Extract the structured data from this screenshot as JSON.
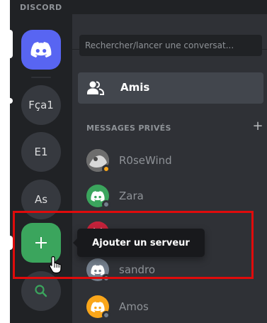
{
  "app": {
    "wordmark": "DISCORD"
  },
  "servers": [
    {
      "label": "Fça1"
    },
    {
      "label": "E1"
    },
    {
      "label": "As"
    }
  ],
  "search": {
    "placeholder": "Rechercher/lancer une conversat..."
  },
  "friends": {
    "label": "Amis"
  },
  "dms": {
    "header": "MESSAGES PRIVÉS",
    "items": [
      {
        "name": "R0seWind",
        "status": "idle",
        "avatar_color": "#9b9b9b"
      },
      {
        "name": "Zara",
        "status": "offline",
        "avatar_color": "#3ba55d"
      },
      {
        "name": "sandro",
        "status": "offline",
        "avatar_color": "#747f8d"
      },
      {
        "name": "Amos",
        "status": "offline",
        "avatar_color": "#faa61a"
      }
    ]
  },
  "tooltip": {
    "text": "Ajouter un serveur"
  },
  "colors": {
    "blurple": "#5865f2",
    "green": "#3ba55d",
    "highlight": "#e00b0b",
    "idle": "#faa61a",
    "offline": "#747f8d"
  }
}
